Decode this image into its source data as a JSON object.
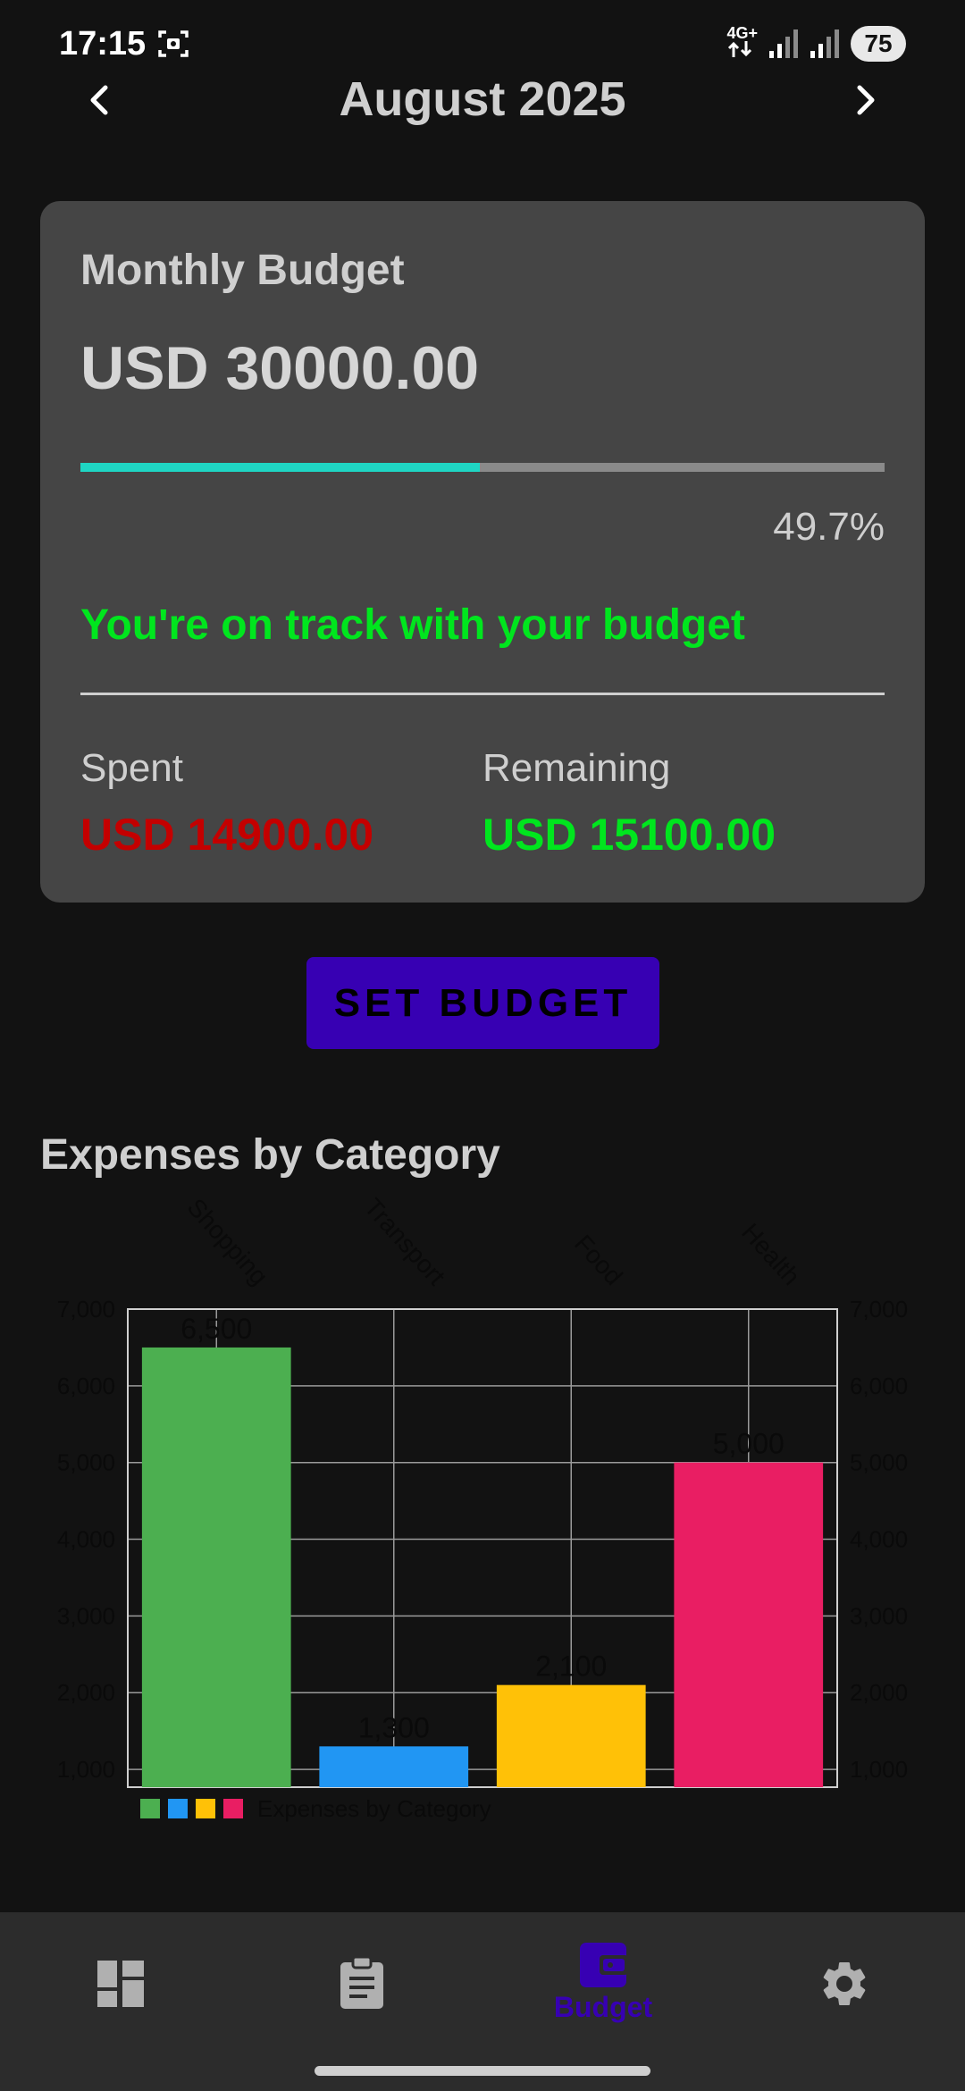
{
  "status": {
    "time": "17:15",
    "network": "4G+",
    "battery": "75"
  },
  "header": {
    "month": "August 2025",
    "prev_icon": "chevron-left-icon",
    "next_icon": "chevron-right-icon"
  },
  "budget": {
    "label": "Monthly Budget",
    "amount": "USD 30000.00",
    "progress_percent": 49.7,
    "progress_text": "49.7%",
    "status_message": "You're on track with your budget",
    "spent_label": "Spent",
    "spent_value": "USD 14900.00",
    "remaining_label": "Remaining",
    "remaining_value": "USD 15100.00",
    "colors": {
      "progress": "#1fd6c4",
      "spent": "#c40000",
      "remaining": "#00e61e"
    }
  },
  "actions": {
    "set_budget_label": "SET BUDGET"
  },
  "section": {
    "title": "Expenses by Category"
  },
  "chart_data": {
    "type": "bar",
    "categories": [
      "Shopping",
      "Transport",
      "Food",
      "Health"
    ],
    "values": [
      6500,
      1300,
      2100,
      5000
    ],
    "value_labels": [
      "6,500",
      "1,300",
      "2,100",
      "5,000"
    ],
    "colors": [
      "#4caf50",
      "#2196f3",
      "#ffc107",
      "#e91e63"
    ],
    "ylim": [
      768,
      7000
    ],
    "yticks": [
      1000,
      2000,
      3000,
      4000,
      5000,
      6000,
      7000
    ],
    "ytick_labels": [
      "1,000",
      "2,000",
      "3,000",
      "4,000",
      "5,000",
      "6,000",
      "7,000"
    ],
    "legend": "Expenses by Category",
    "legend_position": "bottom-left",
    "grid": true
  },
  "nav": {
    "items": [
      {
        "icon": "dashboard-icon",
        "label": ""
      },
      {
        "icon": "clipboard-icon",
        "label": ""
      },
      {
        "icon": "wallet-icon",
        "label": "Budget"
      },
      {
        "icon": "gear-icon",
        "label": ""
      }
    ],
    "active_color": "#3700b3"
  }
}
